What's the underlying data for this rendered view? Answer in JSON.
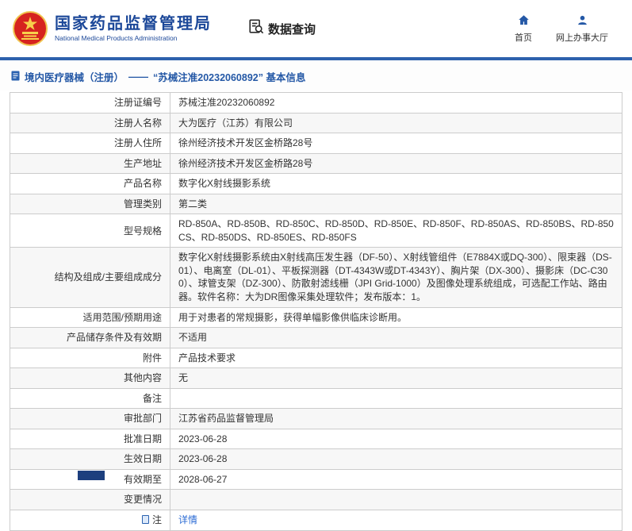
{
  "header": {
    "agency_cn": "国家药品监督管理局",
    "agency_en": "National Medical Products Administration",
    "data_query_label": "数据查询",
    "nav": [
      {
        "label": "首页",
        "icon": "home-icon"
      },
      {
        "label": "网上办事大厅",
        "icon": "user-icon"
      }
    ]
  },
  "breadcrumb": {
    "category": "境内医疗器械（注册）",
    "dash": "——",
    "title": "“苏械注准20232060892” 基本信息",
    "icon": "document-icon"
  },
  "detail_table": {
    "rows": [
      {
        "label": "注册证编号",
        "value": "苏械注准20232060892",
        "type": "text"
      },
      {
        "label": "注册人名称",
        "value": "大为医疗（江苏）有限公司",
        "type": "text"
      },
      {
        "label": "注册人住所",
        "value": "徐州经济技术开发区金桥路28号",
        "type": "text"
      },
      {
        "label": "生产地址",
        "value": "徐州经济技术开发区金桥路28号",
        "type": "text"
      },
      {
        "label": "产品名称",
        "value": "数字化X射线摄影系统",
        "type": "text"
      },
      {
        "label": "管理类别",
        "value": "第二类",
        "type": "text"
      },
      {
        "label": "型号规格",
        "value": "RD-850A、RD-850B、RD-850C、RD-850D、RD-850E、RD-850F、RD-850AS、RD-850BS、RD-850CS、RD-850DS、RD-850ES、RD-850FS",
        "type": "text"
      },
      {
        "label": "结构及组成/主要组成成分",
        "value": "数字化X射线摄影系统由X射线高压发生器（DF-50）、X射线管组件（E7884X或DQ-300）、限束器（DS-01）、电离室（DL-01）、平板探测器（DT-4343W或DT-4343Y）、胸片架（DX-300）、摄影床（DC-C300）、球管支架（DZ-300）、防散射滤线栅（JPI Grid-1000）及图像处理系统组成，可选配工作站、路由器。软件名称：大为DR图像采集处理软件；发布版本：1。",
        "type": "text"
      },
      {
        "label": "适用范围/预期用途",
        "value": "用于对患者的常规摄影，获得单幅影像供临床诊断用。",
        "type": "text"
      },
      {
        "label": "产品储存条件及有效期",
        "value": "不适用",
        "type": "text"
      },
      {
        "label": "附件",
        "value": "产品技术要求",
        "type": "text"
      },
      {
        "label": "其他内容",
        "value": "无",
        "type": "text"
      },
      {
        "label": "备注",
        "value": "",
        "type": "text"
      },
      {
        "label": "审批部门",
        "value": "江苏省药品监督管理局",
        "type": "text"
      },
      {
        "label": "批准日期",
        "value": "2023-06-28",
        "type": "text"
      },
      {
        "label": "生效日期",
        "value": "2023-06-28",
        "type": "text"
      },
      {
        "label": "有效期至",
        "value": "2028-06-27",
        "type": "text"
      },
      {
        "label": "变更情况",
        "value": "",
        "type": "text"
      },
      {
        "label": "注",
        "value": "详情",
        "type": "link",
        "label_icon": true
      }
    ]
  },
  "colors": {
    "title_blue": "#1c4899",
    "bar_blue": "#2d61ad",
    "nav_icon_blue": "#2458a6",
    "link_blue": "#2b6bd4",
    "emblem_red": "#d6231f",
    "emblem_gold": "#f7d04b",
    "row_stripe": "#f7f7f7",
    "table_border": "#cccccc"
  }
}
